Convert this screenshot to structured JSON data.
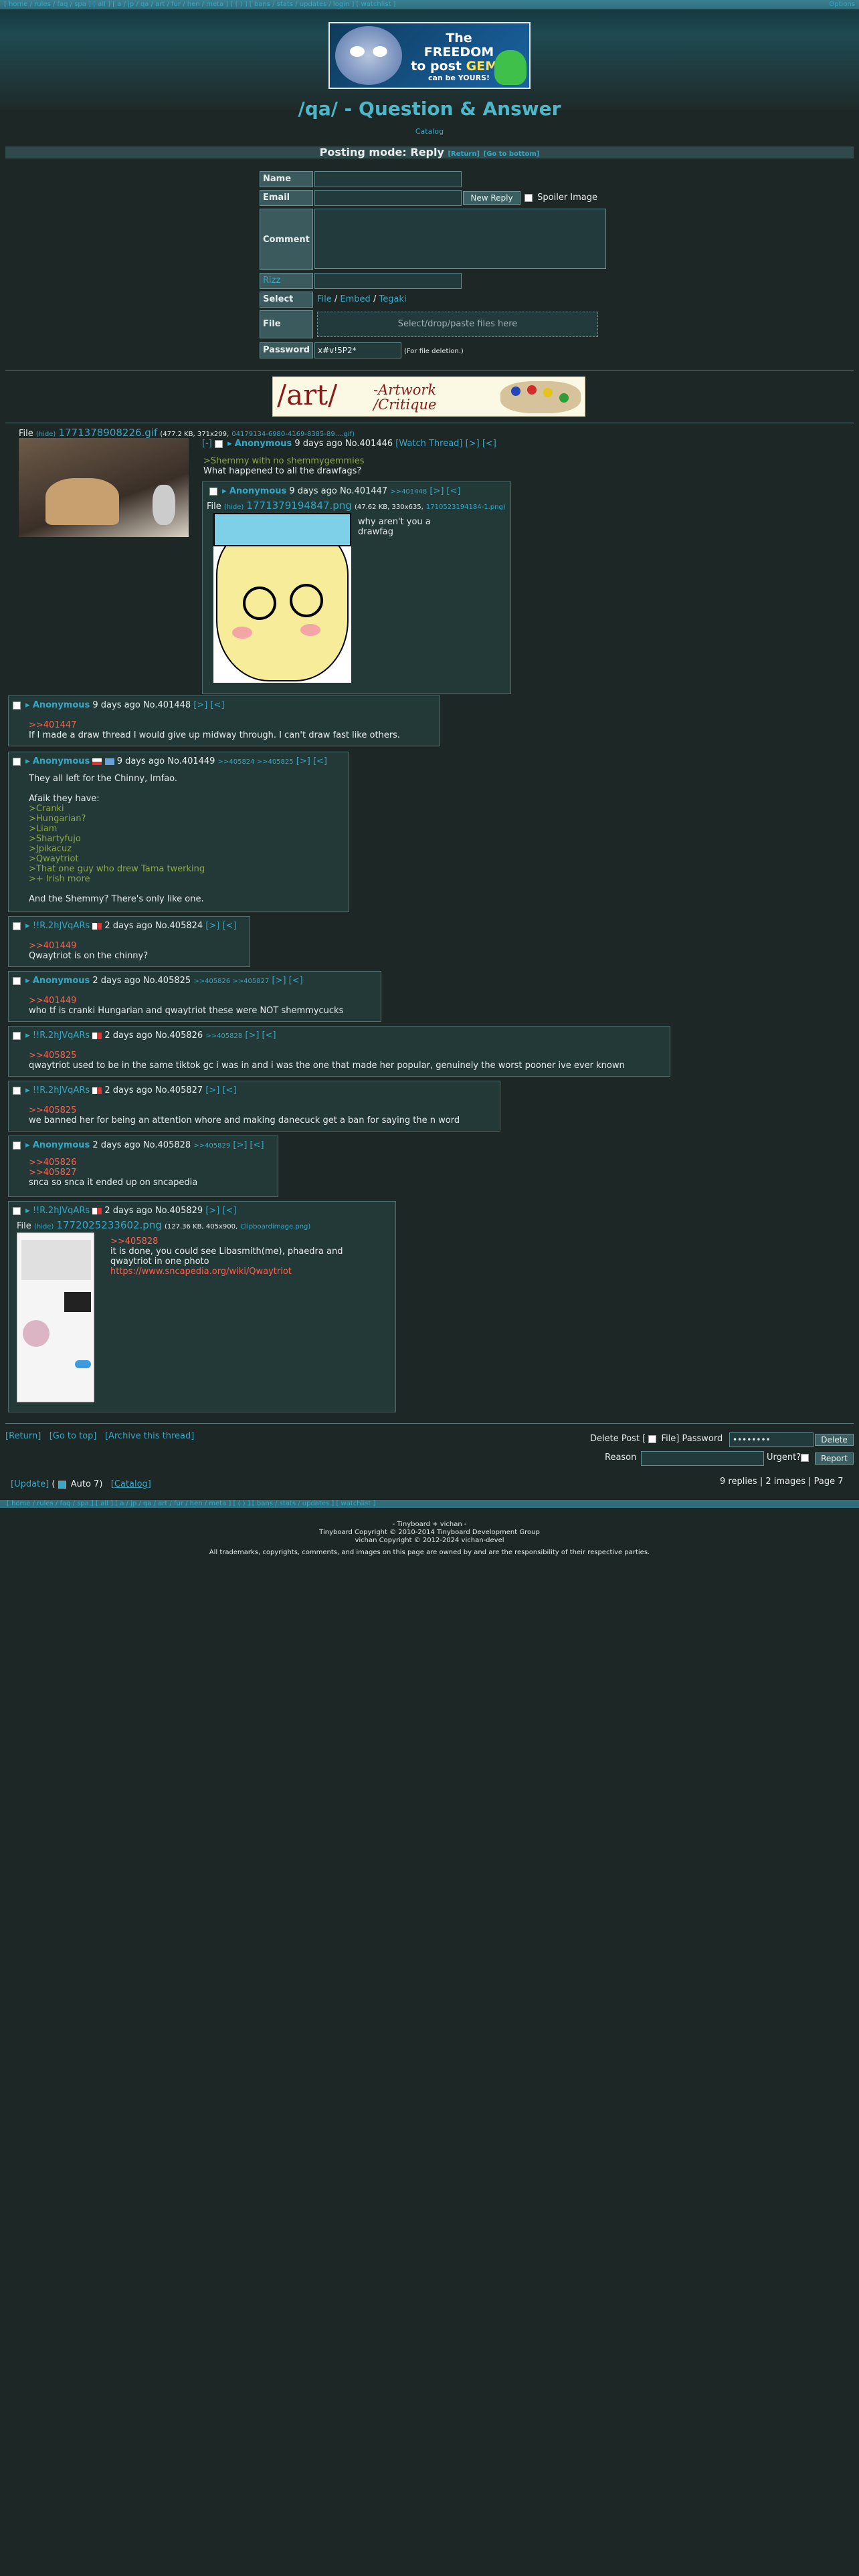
{
  "nav": {
    "links": "[ home / rules / faq / spa ] [ all ] [ a / jp / qa / art / fur / hen / meta ] [ ( ) ] [ bans / stats / updates / login ] [ watchlist ]",
    "right": "Options"
  },
  "banner": {
    "line1": "The FREEDOM",
    "line2a": "to post ",
    "line2b": "GEMS",
    "line3": "can be YOURS!"
  },
  "board_title": "/qa/ - Question & Answer",
  "catalog_link": "Catalog",
  "mode_bar": {
    "text": "Posting mode: Reply",
    "return": "[Return]",
    "bottom": "[Go to bottom]"
  },
  "form": {
    "name_label": "Name",
    "email_label": "Email",
    "new_reply": "New Reply",
    "spoiler": "Spoiler Image",
    "comment_label": "Comment",
    "rizz_label": "Rizz",
    "select_label": "Select",
    "select_file": "File",
    "select_embed": "Embed",
    "select_tegaki": "Tegaki",
    "file_label": "File",
    "dropzone": "Select/drop/paste files here",
    "password_label": "Password",
    "password_value": "x#v!5P2*",
    "password_note": "(For file deletion.)"
  },
  "ad": {
    "art": "/art/",
    "caption1": "-Artwork",
    "caption2": "/Critique"
  },
  "op": {
    "file_label": "File",
    "hide": "(hide)",
    "filename": "1771378908226.gif",
    "meta": "(477.2 KB, 371x209,",
    "orig": "04179134-6980-4169-8385-89....gif)",
    "hide_btn": "[-]",
    "name": "Anonymous",
    "time": "9 days ago",
    "no": "No.401446",
    "watch": "[Watch Thread]",
    "arrows": "[>] [<]",
    "greentext": ">Shemmy with no shemmygemmies",
    "text": "What happened to all the drawfags?"
  },
  "replies": [
    {
      "name": "Anonymous",
      "time": "9 days ago",
      "no": "No.401447",
      "backlinks": ">>401448",
      "arrows": "[>] [<]",
      "file_label": "File",
      "hide": "(hide)",
      "filename": "1771379194847.png",
      "meta": "(47.62 KB, 330x635,",
      "orig": "1710523194184-1.png)",
      "text1": "why aren't you a",
      "text2": "drawfag"
    },
    {
      "name": "Anonymous",
      "time": "9 days ago",
      "no": "No.401448",
      "arrows": "[>] [<]",
      "quote": ">>401447",
      "text": "If I made a draw thread I would give up midway through. I can't draw fast like others."
    },
    {
      "name": "Anonymous",
      "time": "9 days ago",
      "no": "No.401449",
      "backlinks": ">>405824 >>405825",
      "arrows": "[>] [<]",
      "lines": [
        "They all left for the Chinny, lmfao.",
        "",
        "Afaik they have:",
        ">Cranki",
        ">Hungarian?",
        ">Liam",
        ">Shartyfujo",
        ">Jpikacuz",
        ">Qwaytriot",
        ">That one guy who drew Tama twerking",
        ">+ Irish more",
        "",
        "And the Shemmy? There's only like one."
      ]
    },
    {
      "name": "!!R.2hJVqARs",
      "time": "2 days ago",
      "no": "No.405824",
      "arrows": "[>] [<]",
      "quote": ">>401449",
      "text": "Qwaytriot is on the chinny?"
    },
    {
      "name": "Anonymous",
      "time": "2 days ago",
      "no": "No.405825",
      "backlinks": ">>405826 >>405827",
      "arrows": "[>] [<]",
      "quote": ">>401449",
      "text": "who tf is cranki Hungarian and qwaytriot these were NOT shemmycucks"
    },
    {
      "name": "!!R.2hJVqARs",
      "time": "2 days ago",
      "no": "No.405826",
      "backlinks": ">>405828",
      "arrows": "[>] [<]",
      "quote": ">>405825",
      "text": "qwaytriot used to be in the same tiktok gc i was in and i was the one that made her popular, genuinely the worst pooner ive ever known"
    },
    {
      "name": "!!R.2hJVqARs",
      "time": "2 days ago",
      "no": "No.405827",
      "arrows": "[>] [<]",
      "quote": ">>405825",
      "text": "we banned her for being an attention whore and making danecuck get a ban for saying the n word"
    },
    {
      "name": "Anonymous",
      "time": "2 days ago",
      "no": "No.405828",
      "backlinks": ">>405829",
      "arrows": "[>] [<]",
      "quote1": ">>405826",
      "quote2": ">>405827",
      "text": "snca so snca it ended up on sncapedia"
    },
    {
      "name": "!!R.2hJVqARs",
      "time": "2 days ago",
      "no": "No.405829",
      "arrows": "[>] [<]",
      "file_label": "File",
      "hide": "(hide)",
      "filename": "1772025233602.png",
      "meta": "(127.36 KB, 405x900,",
      "orig": "Clipboardimage.png)",
      "quote": ">>405828",
      "text1": "it is done, you could see Libasmith(me), phaedra and",
      "text2": "qwaytriot in one photo",
      "url": "https://www.sncapedia.org/wiki/Qwaytriot"
    }
  ],
  "footer": {
    "return": "[Return]",
    "top": "[Go to top]",
    "archive": "[Archive this thread]",
    "delete_post": "Delete Post [",
    "file": "File]",
    "password": "Password",
    "password_value": "••••••••",
    "delete_btn": "Delete",
    "reason": "Reason",
    "urgent": "Urgent?",
    "report_btn": "Report",
    "update": "[Update]",
    "auto": "Auto",
    "auto_count": "7",
    "catalog": "[Catalog]",
    "stats": "9 replies | 2 images | Page 7"
  },
  "bottom_nav": "[ home / rules / faq / spa ] [ all ] [ a / jp / qa / art / fur / hen / meta ] [ ( ) ] [ bans / stats / updates ] [ watchlist ]",
  "copyright": {
    "line1": "- Tinyboard + vichan -",
    "line2": "Tinyboard Copyright © 2010-2014 Tinyboard Development Group",
    "line3": "vichan Copyright © 2012-2024 vichan-devel",
    "line4": "All trademarks, copyrights, comments, and images on this page are owned by and are the responsibility of their respective parties."
  }
}
